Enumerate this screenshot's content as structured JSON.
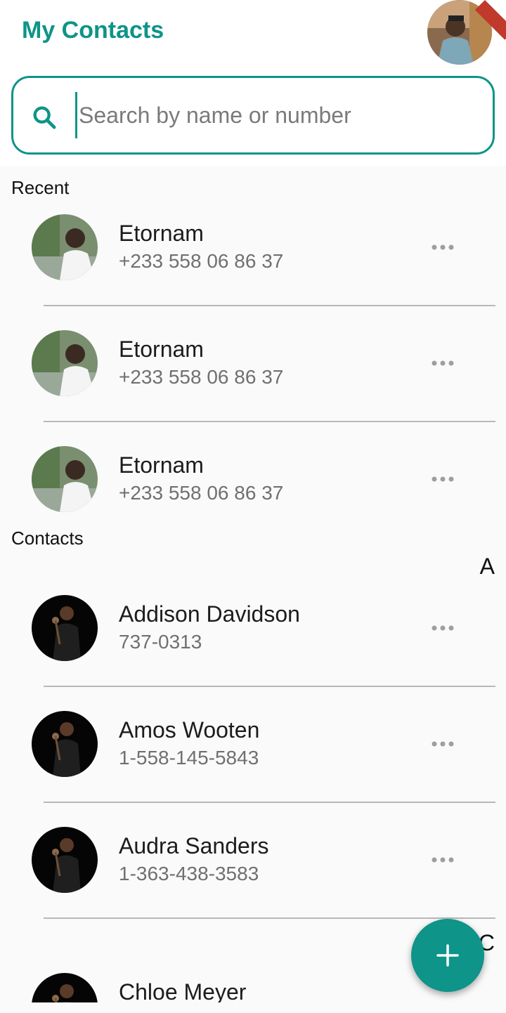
{
  "header": {
    "title": "My Contacts"
  },
  "search": {
    "placeholder": "Search by name or number"
  },
  "sections": {
    "recent": "Recent",
    "contacts": "Contacts"
  },
  "recent": [
    {
      "name": "Etornam",
      "phone": "+233 558 06 86 37"
    },
    {
      "name": "Etornam",
      "phone": "+233 558 06 86 37"
    },
    {
      "name": "Etornam",
      "phone": "+233 558 06 86 37"
    }
  ],
  "letters": {
    "a": "A",
    "c": "C"
  },
  "contacts": [
    {
      "name": "Addison Davidson",
      "phone": "737-0313"
    },
    {
      "name": "Amos Wooten",
      "phone": "1-558-145-5843"
    },
    {
      "name": "Audra Sanders",
      "phone": "1-363-438-3583"
    },
    {
      "name": "Chloe Meyer",
      "phone": ""
    }
  ],
  "icons": {
    "search": "search-icon",
    "more": "more-horizontal-icon",
    "add": "add-icon"
  },
  "colors": {
    "accent": "#0e9488",
    "background": "#fafafa"
  }
}
